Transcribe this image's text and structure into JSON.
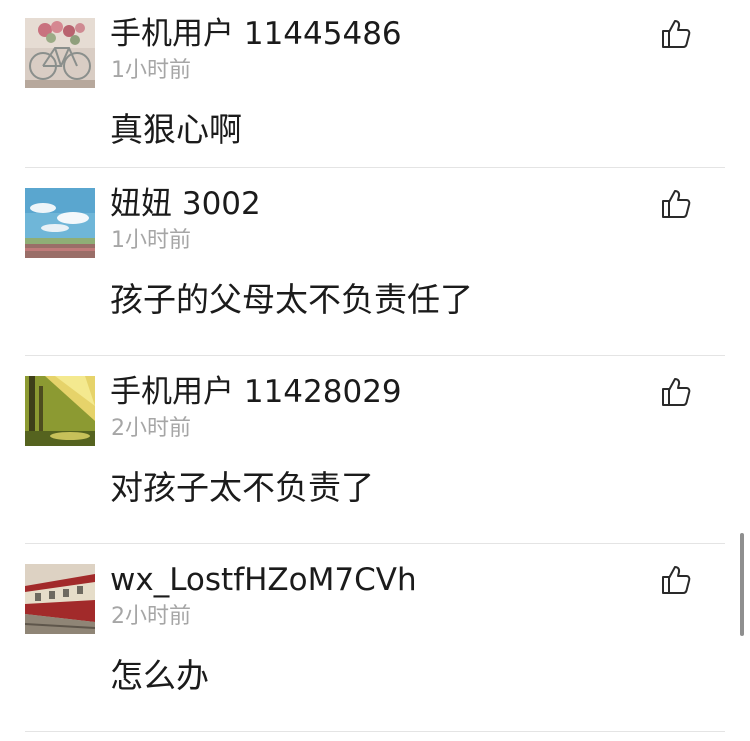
{
  "comments": [
    {
      "username": "手机用户 11445486",
      "time": "1小时前",
      "content": "真狠心啊",
      "avatar": "bicycle-flowers-avatar",
      "like_icon": "thumbs-up-icon"
    },
    {
      "username": "妞妞 3002",
      "time": "1小时前",
      "content": "孩子的父母太不负责任了",
      "avatar": "sky-field-avatar",
      "like_icon": "thumbs-up-icon"
    },
    {
      "username": "手机用户 11428029",
      "time": "2小时前",
      "content": "对孩子太不负责了",
      "avatar": "sunlit-forest-avatar",
      "like_icon": "thumbs-up-icon"
    },
    {
      "username": "wx_LostfHZoM7CVh",
      "time": "2小时前",
      "content": "怎么办",
      "avatar": "red-train-avatar",
      "like_icon": "thumbs-up-icon"
    }
  ]
}
